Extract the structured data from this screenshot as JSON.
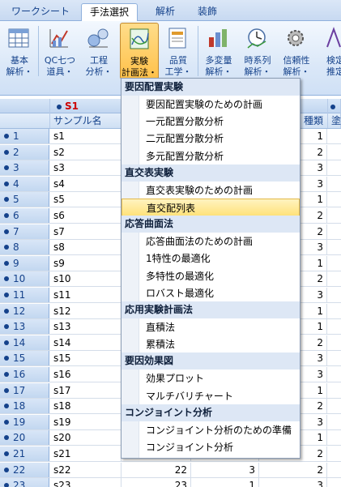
{
  "tabs": [
    "ワークシート",
    "手法選択",
    "解析",
    "装飾"
  ],
  "ribbon": [
    {
      "label": "基本\n解析・",
      "icon": "basic-analysis-icon"
    },
    {
      "label": "QC七つ\n道具・",
      "icon": "qc-tools-icon"
    },
    {
      "label": "工程\n分析・",
      "icon": "process-analysis-icon"
    },
    {
      "label": "実験\n計画法・",
      "icon": "doe-icon"
    },
    {
      "label": "品質\n工学・",
      "icon": "quality-engineering-icon"
    },
    {
      "label": "多変量\n解析・",
      "icon": "multivariate-icon"
    },
    {
      "label": "時系列\n解析・",
      "icon": "time-series-icon"
    },
    {
      "label": "信頼性\n解析・",
      "icon": "reliability-icon"
    },
    {
      "label": "検定\n推定",
      "icon": "test-estimate-icon"
    }
  ],
  "grid": {
    "col_marker": "S1",
    "col_name_header": "サンプル名",
    "col_kind_header": "種類",
    "col_right_header": "塗",
    "rows": [
      {
        "n": "1",
        "name": "s1",
        "v1": "",
        "v2": "",
        "v3": "1"
      },
      {
        "n": "2",
        "name": "s2",
        "v1": "",
        "v2": "",
        "v3": "2"
      },
      {
        "n": "3",
        "name": "s3",
        "v1": "",
        "v2": "",
        "v3": "3"
      },
      {
        "n": "4",
        "name": "s4",
        "v1": "",
        "v2": "",
        "v3": "3"
      },
      {
        "n": "5",
        "name": "s5",
        "v1": "",
        "v2": "",
        "v3": "1"
      },
      {
        "n": "6",
        "name": "s6",
        "v1": "",
        "v2": "",
        "v3": "2"
      },
      {
        "n": "7",
        "name": "s7",
        "v1": "",
        "v2": "",
        "v3": "2"
      },
      {
        "n": "8",
        "name": "s8",
        "v1": "",
        "v2": "",
        "v3": "3"
      },
      {
        "n": "9",
        "name": "s9",
        "v1": "",
        "v2": "",
        "v3": "1"
      },
      {
        "n": "10",
        "name": "s10",
        "v1": "",
        "v2": "",
        "v3": "2"
      },
      {
        "n": "11",
        "name": "s11",
        "v1": "",
        "v2": "",
        "v3": "3"
      },
      {
        "n": "12",
        "name": "s12",
        "v1": "",
        "v2": "",
        "v3": "1"
      },
      {
        "n": "13",
        "name": "s13",
        "v1": "",
        "v2": "",
        "v3": "1"
      },
      {
        "n": "14",
        "name": "s14",
        "v1": "",
        "v2": "",
        "v3": "2"
      },
      {
        "n": "15",
        "name": "s15",
        "v1": "",
        "v2": "",
        "v3": "3"
      },
      {
        "n": "16",
        "name": "s16",
        "v1": "",
        "v2": "",
        "v3": "3"
      },
      {
        "n": "17",
        "name": "s17",
        "v1": "",
        "v2": "",
        "v3": "1"
      },
      {
        "n": "18",
        "name": "s18",
        "v1": "",
        "v2": "",
        "v3": "2"
      },
      {
        "n": "19",
        "name": "s19",
        "v1": "",
        "v2": "",
        "v3": "3"
      },
      {
        "n": "20",
        "name": "s20",
        "v1": "",
        "v2": "",
        "v3": "1"
      },
      {
        "n": "21",
        "name": "s21",
        "v1": "",
        "v2": "",
        "v3": "2"
      },
      {
        "n": "22",
        "name": "s22",
        "v1": "22",
        "v2": "3",
        "v3": "2"
      },
      {
        "n": "23",
        "name": "s23",
        "v1": "23",
        "v2": "1",
        "v3": "3"
      }
    ]
  },
  "menu": [
    {
      "type": "head",
      "label": "要因配置実験"
    },
    {
      "type": "item",
      "label": "要因配置実験のための計画"
    },
    {
      "type": "item",
      "label": "一元配置分散分析"
    },
    {
      "type": "item",
      "label": "二元配置分散分析"
    },
    {
      "type": "item",
      "label": "多元配置分散分析"
    },
    {
      "type": "head",
      "label": "直交表実験"
    },
    {
      "type": "item",
      "label": "直交表実験のための計画"
    },
    {
      "type": "item",
      "label": "直交配列表",
      "highlight": true
    },
    {
      "type": "head",
      "label": "応答曲面法"
    },
    {
      "type": "item",
      "label": "応答曲面法のための計画"
    },
    {
      "type": "item",
      "label": "1特性の最適化"
    },
    {
      "type": "item",
      "label": "多特性の最適化"
    },
    {
      "type": "item",
      "label": "ロバスト最適化"
    },
    {
      "type": "head",
      "label": "応用実験計画法"
    },
    {
      "type": "item",
      "label": "直積法"
    },
    {
      "type": "item",
      "label": "累積法"
    },
    {
      "type": "head",
      "label": "要因効果図"
    },
    {
      "type": "item",
      "label": "効果プロット"
    },
    {
      "type": "item",
      "label": "マルチバリチャート"
    },
    {
      "type": "head",
      "label": "コンジョイント分析"
    },
    {
      "type": "item",
      "label": "コンジョイント分析のための準備"
    },
    {
      "type": "item",
      "label": "コンジョイント分析"
    }
  ]
}
